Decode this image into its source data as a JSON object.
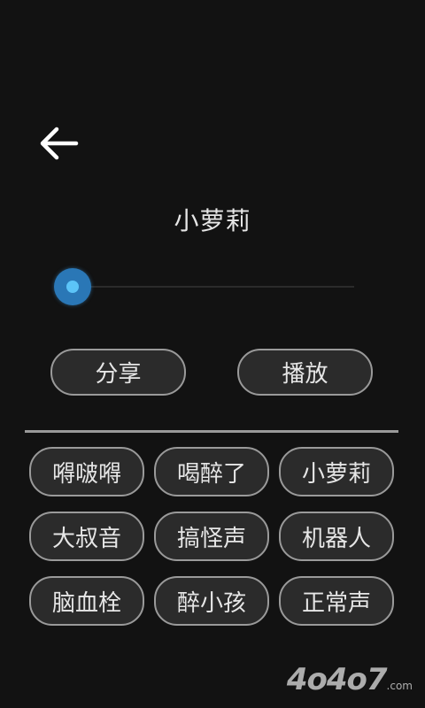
{
  "header": {
    "back_icon": "arrow-left-icon",
    "title": "小萝莉"
  },
  "slider": {
    "value_fraction": 0.0
  },
  "actions": {
    "share_label": "分享",
    "play_label": "播放"
  },
  "effects": [
    {
      "label": "嘚啵嘚"
    },
    {
      "label": "喝醉了"
    },
    {
      "label": "小萝莉"
    },
    {
      "label": "大叔音"
    },
    {
      "label": "搞怪声"
    },
    {
      "label": "机器人"
    },
    {
      "label": "脑血栓"
    },
    {
      "label": "醉小孩"
    },
    {
      "label": "正常声"
    }
  ],
  "watermark": {
    "text": "4o4o7",
    "suffix": ".com"
  },
  "colors": {
    "background": "#121212",
    "accent": "#2e8ed6",
    "button_border": "#9a9a9a"
  }
}
